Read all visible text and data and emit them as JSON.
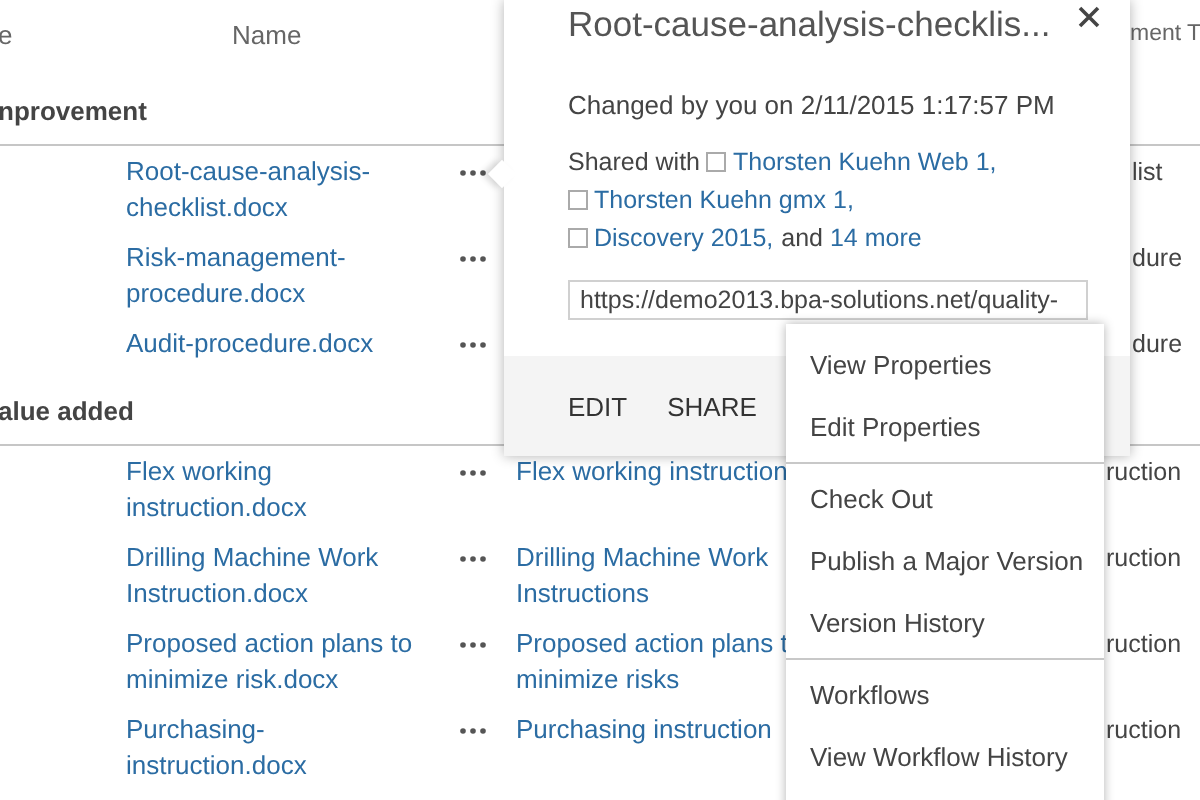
{
  "list": {
    "header": {
      "column_1": "e",
      "column_2": "Name",
      "column_5": "ment T"
    },
    "groups": [
      {
        "title": "nprovement",
        "rows": [
          {
            "name": "Root-cause-analysis-checklist.docx",
            "title": [],
            "column_5": "list"
          },
          {
            "name": "Risk-management-procedure.docx",
            "title": [],
            "column_5": "dure"
          },
          {
            "name": "Audit-procedure.docx",
            "title": [],
            "column_5": "dure"
          }
        ]
      },
      {
        "title": "alue added",
        "rows": [
          {
            "name": "Flex working instruction.docx",
            "title": [
              "Flex working instruction"
            ],
            "column_5": "ruction"
          },
          {
            "name": "Drilling Machine Work Instruction.docx",
            "title": [
              "Drilling Machine Work",
              "Instructions"
            ],
            "column_5": "ruction"
          },
          {
            "name": "Proposed action plans to minimize risk.docx",
            "title": [
              "Proposed action plans t",
              "minimize risks"
            ],
            "column_5": "ruction"
          },
          {
            "name": "Purchasing-instruction.docx",
            "title": [
              "Purchasing instruction"
            ],
            "column_5": "ruction"
          }
        ]
      }
    ]
  },
  "callout": {
    "title": "Root-cause-analysis-checklis...",
    "changed": "Changed by you on 2/11/2015 1:17:57 PM",
    "shared_prefix": "Shared with",
    "shared_with": [
      "Thorsten Kuehn Web 1,",
      "Thorsten Kuehn gmx 1,",
      "Discovery 2015,"
    ],
    "and": "and",
    "more_link": "14 more",
    "url": "https://demo2013.bpa-solutions.net/quality-",
    "actions": [
      "EDIT",
      "SHARE"
    ]
  },
  "menu": {
    "sections": [
      [
        "View Properties",
        "Edit Properties"
      ],
      [
        "Check Out",
        "Publish a Major Version",
        "Version History"
      ],
      [
        "Workflows",
        "View Workflow History"
      ]
    ]
  }
}
